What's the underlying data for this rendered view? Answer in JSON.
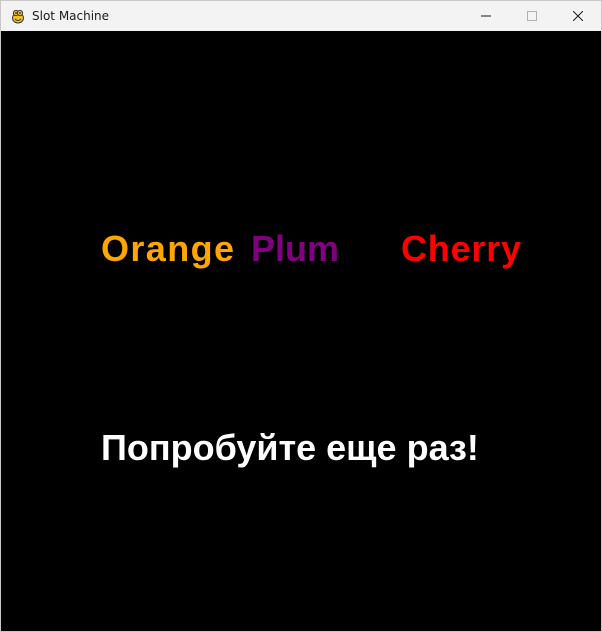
{
  "window": {
    "title": "Slot Machine",
    "app_icon": "pygame-snake-icon",
    "controls": [
      "minimize-icon",
      "maximize-icon",
      "close-icon"
    ]
  },
  "reels": [
    {
      "label": "Orange",
      "color": "#ffa500"
    },
    {
      "label": "Plum",
      "color": "#800080"
    },
    {
      "label": "Cherry",
      "color": "#ff0000"
    }
  ],
  "message": "Попробуйте еще раз!",
  "colors": {
    "background": "#000000",
    "message": "#ffffff",
    "titlebar": "#f3f3f3"
  }
}
